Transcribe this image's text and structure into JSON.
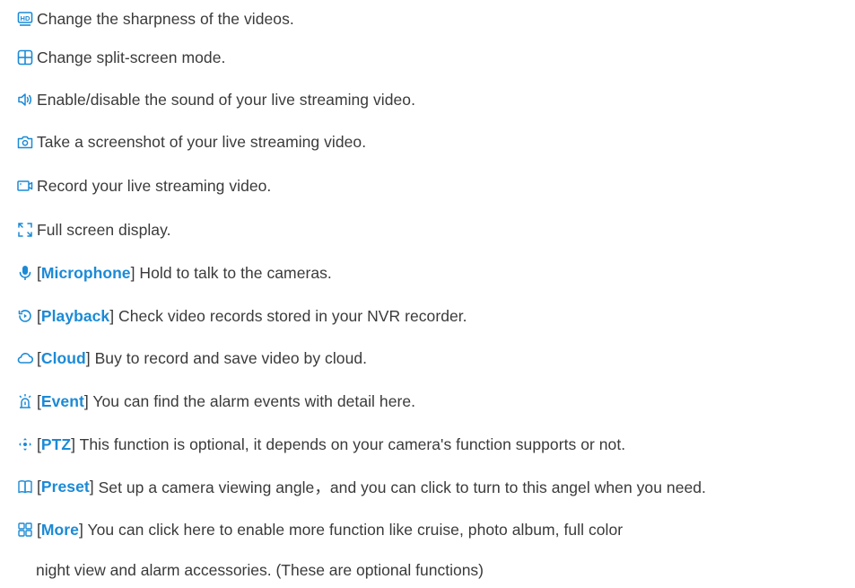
{
  "accent": "#1b8ad6",
  "items": [
    {
      "icon": "hd-icon",
      "text": "Change the sharpness of the videos."
    },
    {
      "icon": "split-screen-icon",
      "text": "Change split-screen mode."
    },
    {
      "icon": "speaker-icon",
      "text": "Enable/disable the sound of your live streaming video."
    },
    {
      "icon": "camera-icon",
      "text": "Take a screenshot of your live streaming video."
    },
    {
      "icon": "video-record-icon",
      "text": "Record your live streaming video."
    },
    {
      "icon": "fullscreen-icon",
      "text": "Full screen display."
    },
    {
      "icon": "microphone-icon",
      "keyword": "Microphone",
      "text": " Hold to talk to the cameras."
    },
    {
      "icon": "playback-icon",
      "keyword": "Playback",
      "text": " Check video records stored in your NVR recorder."
    },
    {
      "icon": "cloud-icon",
      "keyword": "Cloud",
      "text": " Buy to record and save video by cloud."
    },
    {
      "icon": "alarm-icon",
      "keyword": "Event",
      "text": " You can find the alarm events with detail here."
    },
    {
      "icon": "ptz-icon",
      "keyword": "PTZ",
      "text": " This function is optional, it depends on your camera's function supports or not."
    },
    {
      "icon": "preset-icon",
      "keyword": "Preset",
      "text": " Set up a camera viewing angle，and you can click to turn to this angel when you need."
    },
    {
      "icon": "more-icon",
      "keyword": "More",
      "text": " You can click here to enable more function like cruise, photo album, full color"
    }
  ],
  "continuation": "night view and alarm accessories. (These are optional functions)"
}
